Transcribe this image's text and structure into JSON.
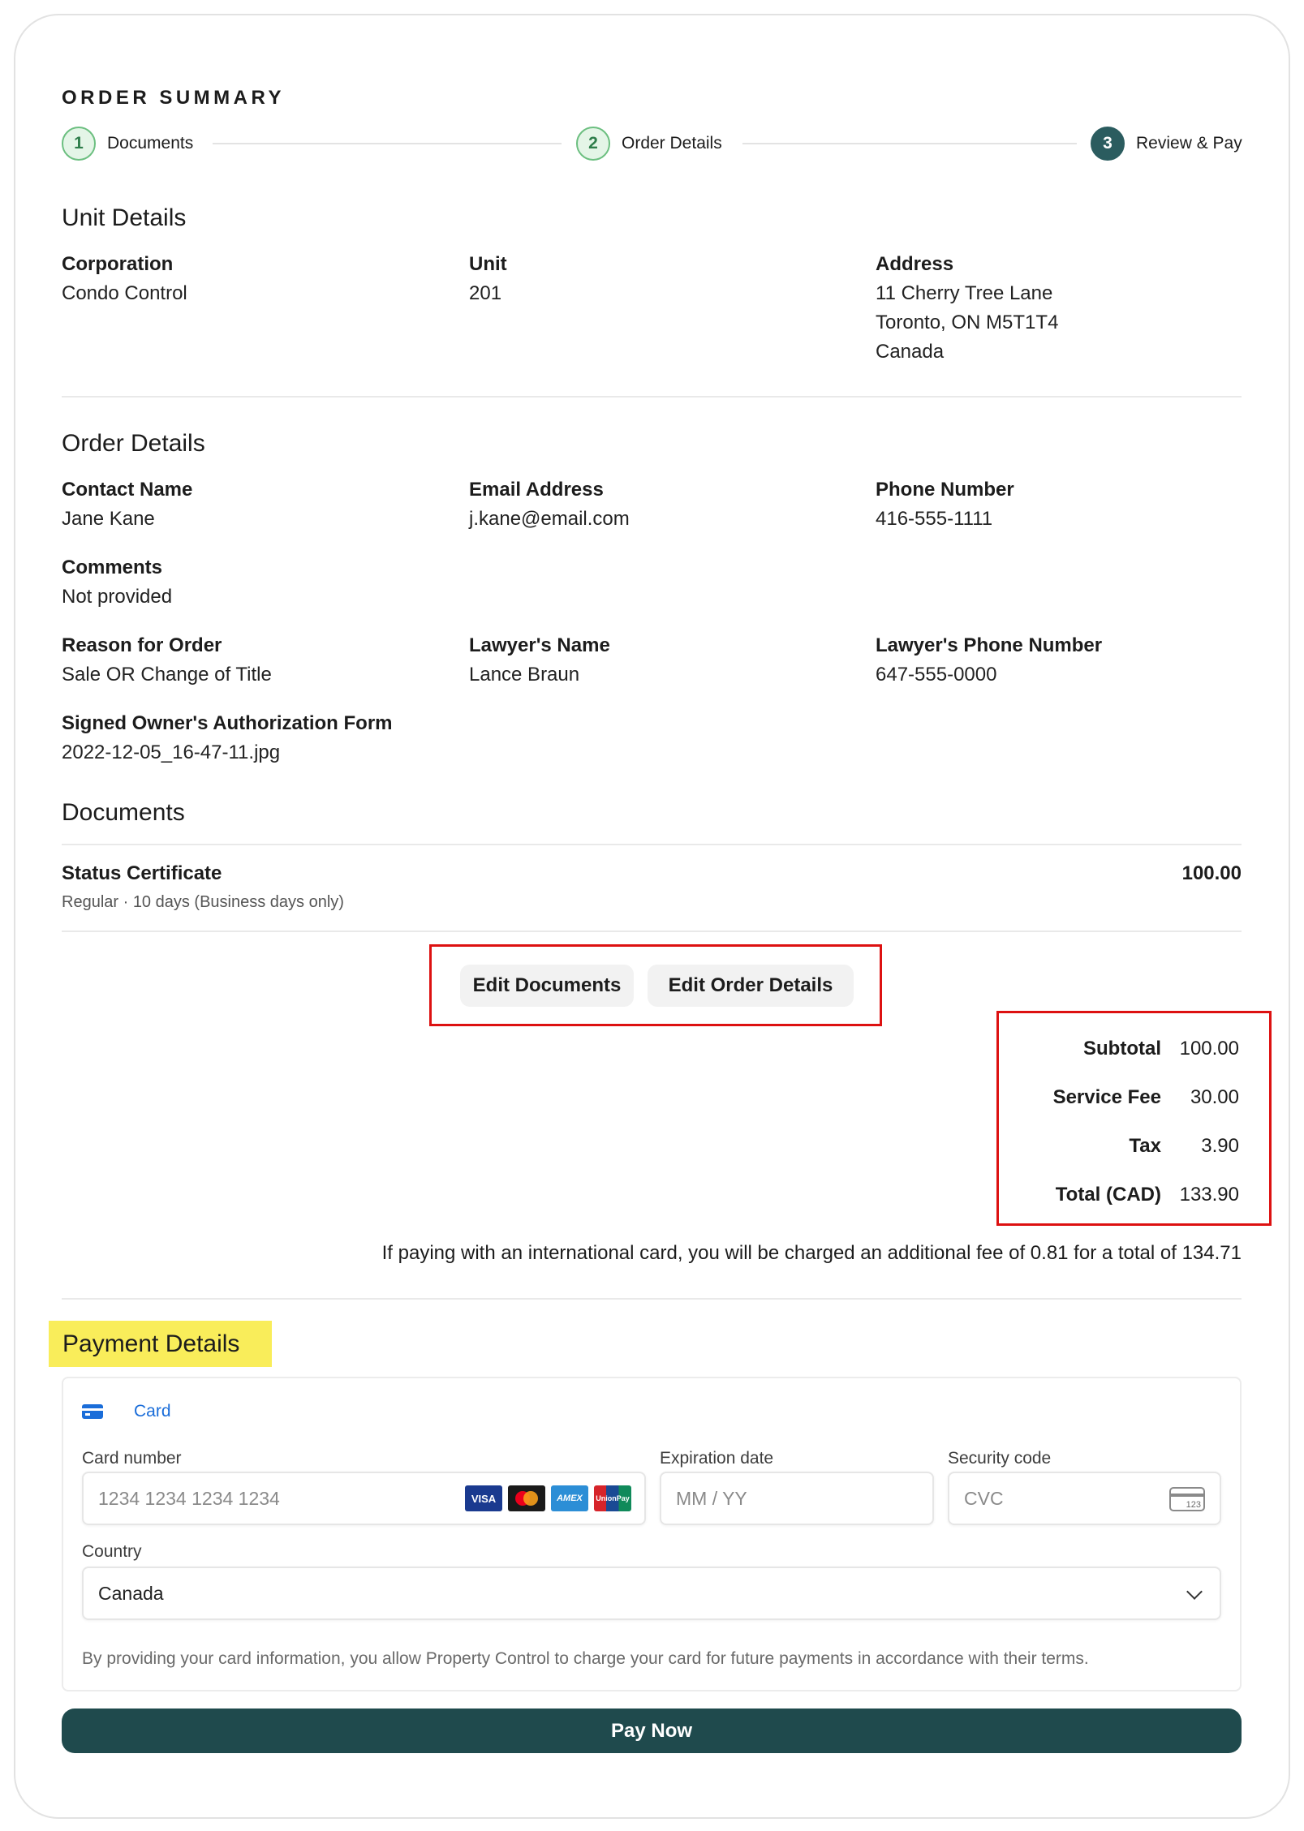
{
  "header": {
    "title": "ORDER SUMMARY",
    "steps": [
      {
        "number": "1",
        "label": "Documents"
      },
      {
        "number": "2",
        "label": "Order Details"
      },
      {
        "number": "3",
        "label": "Review & Pay"
      }
    ]
  },
  "unit_details": {
    "title": "Unit Details",
    "corporation_label": "Corporation",
    "corporation_value": "Condo Control",
    "unit_label": "Unit",
    "unit_value": "201",
    "address_label": "Address",
    "address_line1": "11 Cherry Tree Lane",
    "address_line2": "Toronto, ON M5T1T4",
    "address_line3": "Canada"
  },
  "order_details": {
    "title": "Order Details",
    "contact_name_label": "Contact Name",
    "contact_name_value": "Jane Kane",
    "email_label": "Email Address",
    "email_value": "j.kane@email.com",
    "phone_label": "Phone Number",
    "phone_value": "416-555-1111",
    "comments_label": "Comments",
    "comments_value": "Not provided",
    "reason_label": "Reason for Order",
    "reason_value": "Sale OR Change of Title",
    "lawyer_name_label": "Lawyer's Name",
    "lawyer_name_value": "Lance Braun",
    "lawyer_phone_label": "Lawyer's Phone Number",
    "lawyer_phone_value": "647-555-0000",
    "auth_form_label": "Signed Owner's Authorization Form",
    "auth_form_value": "2022-12-05_16-47-11.jpg"
  },
  "documents": {
    "title": "Documents",
    "items": [
      {
        "name": "Status Certificate",
        "detail": "Regular · 10 days (Business days only)",
        "price": "100.00"
      }
    ]
  },
  "actions": {
    "edit_documents": "Edit Documents",
    "edit_order_details": "Edit Order Details"
  },
  "totals": {
    "subtotal_label": "Subtotal",
    "subtotal_value": "100.00",
    "service_fee_label": "Service Fee",
    "service_fee_value": "30.00",
    "tax_label": "Tax",
    "tax_value": "3.90",
    "total_label": "Total (CAD)",
    "total_value": "133.90",
    "international_note": "If paying with an international card, you will be charged an additional fee of 0.81 for a total of 134.71"
  },
  "payment": {
    "title": "Payment Details",
    "method_tab": "Card",
    "card_number_label": "Card number",
    "card_number_placeholder": "1234 1234 1234 1234",
    "expiration_label": "Expiration date",
    "expiration_placeholder": "MM / YY",
    "security_label": "Security code",
    "security_placeholder": "CVC",
    "cvc_icon_text": "123",
    "brands": [
      "VISA",
      "",
      "AMEX",
      "UnionPay"
    ],
    "country_label": "Country",
    "country_value": "Canada",
    "terms": "By providing your card information, you allow Property Control to charge your card for future payments in accordance with their terms.",
    "pay_button": "Pay Now"
  },
  "colors": {
    "accent": "#1f4a4d",
    "step_done": "#6cbf80",
    "highlight": "#f9ed5a",
    "annotation": "#dd1111",
    "link_blue": "#1a6dd9"
  }
}
